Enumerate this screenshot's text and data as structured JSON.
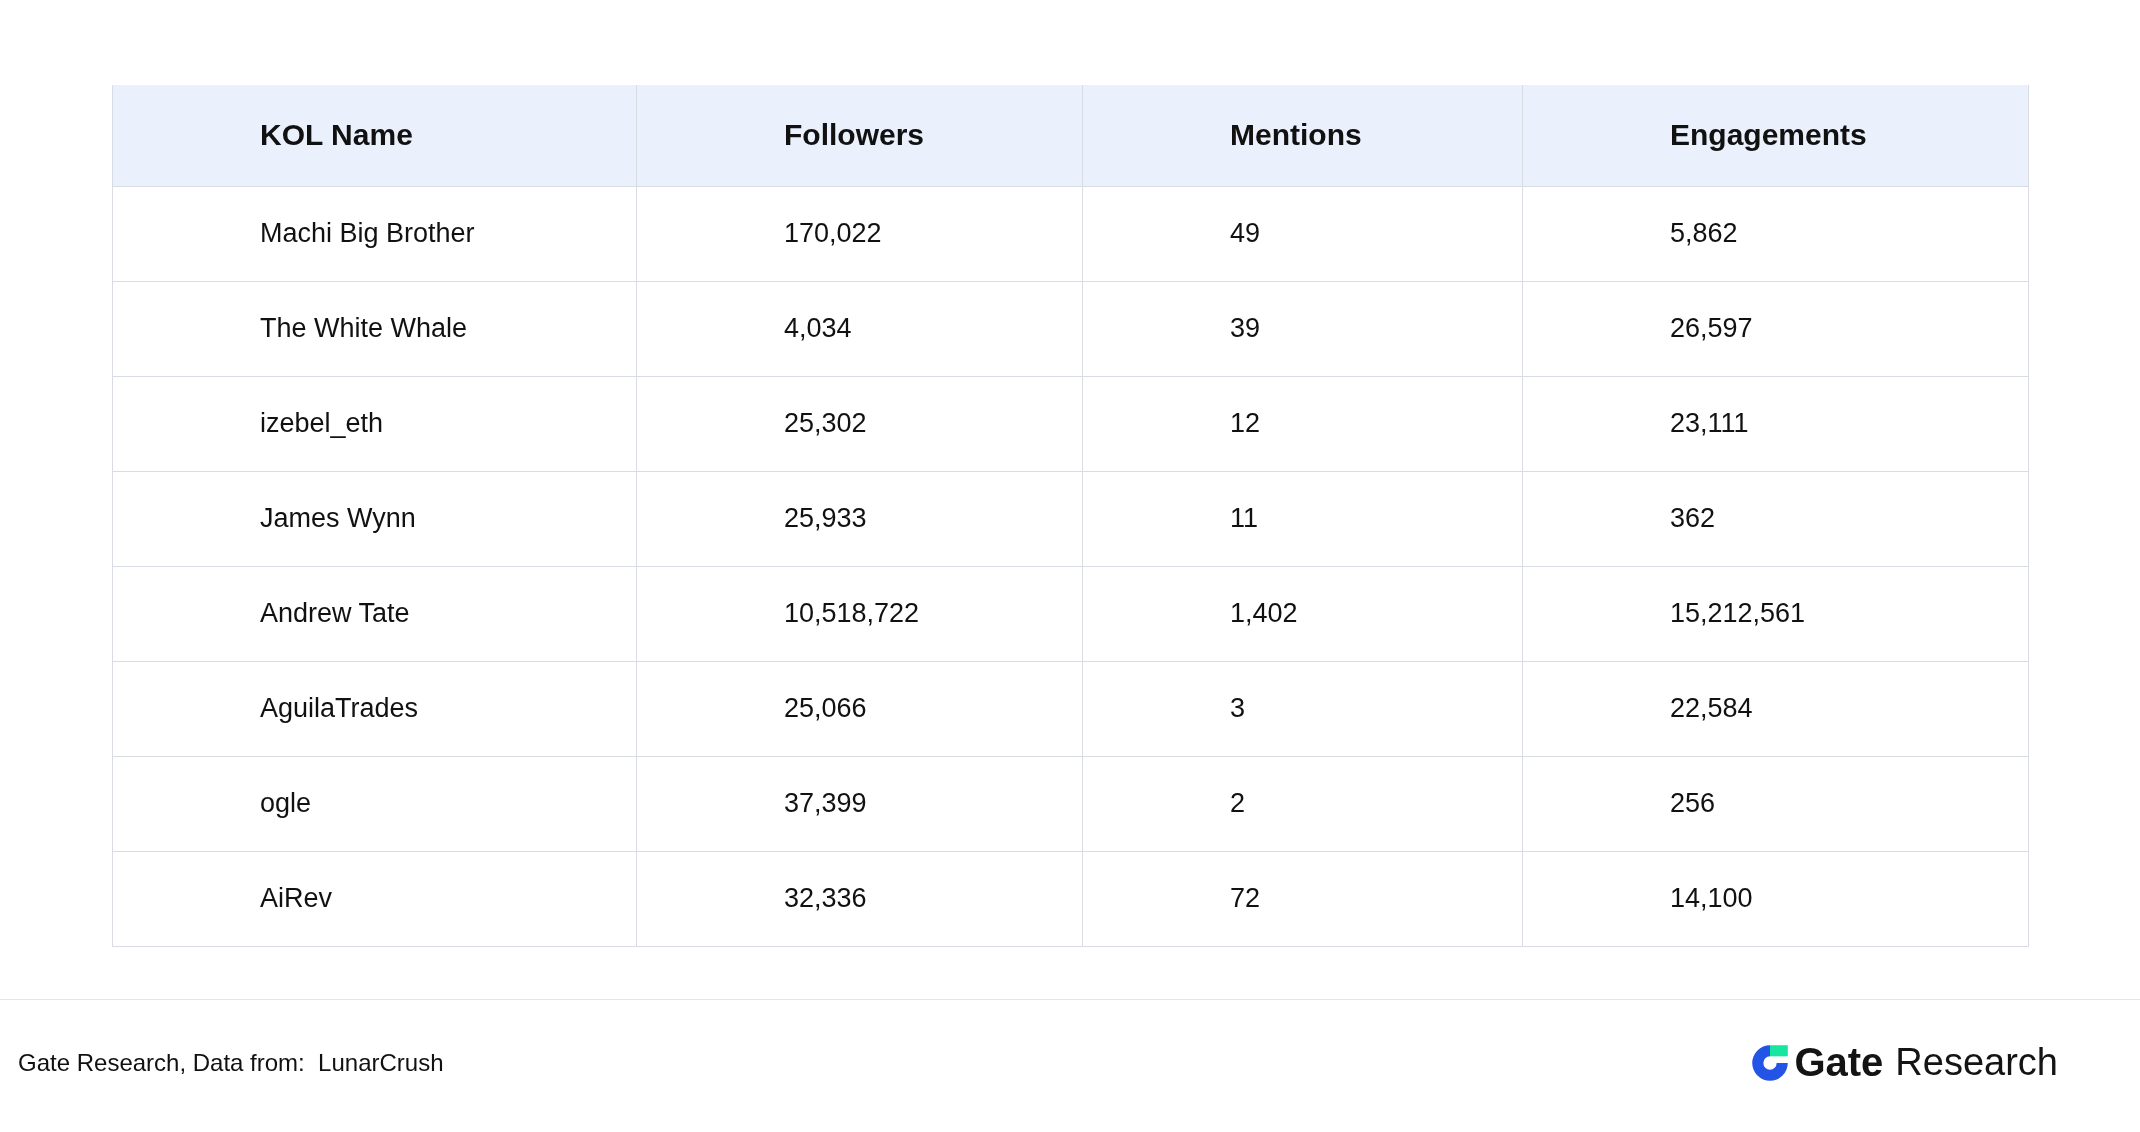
{
  "table": {
    "columns": [
      "KOL Name",
      "Followers",
      "Mentions",
      "Engagements"
    ],
    "rows": [
      [
        "Machi Big Brother",
        "170,022",
        "49",
        "5,862"
      ],
      [
        "The White Whale",
        "4,034",
        "39",
        "26,597"
      ],
      [
        "izebel_eth",
        "25,302",
        "12",
        "23,111"
      ],
      [
        "James Wynn",
        "25,933",
        "11",
        "362"
      ],
      [
        "Andrew Tate",
        "10,518,722",
        "1,402",
        "15,212,561"
      ],
      [
        "AguilaTrades",
        "25,066",
        "3",
        "22,584"
      ],
      [
        "ogle",
        "37,399",
        "2",
        "256"
      ],
      [
        "AiRev",
        "32,336",
        "72",
        "14,100"
      ]
    ]
  },
  "footer": {
    "source": "Gate Research, Data from:  LunarCrush",
    "logo": {
      "brand": "Gate",
      "name": "Research"
    }
  }
}
